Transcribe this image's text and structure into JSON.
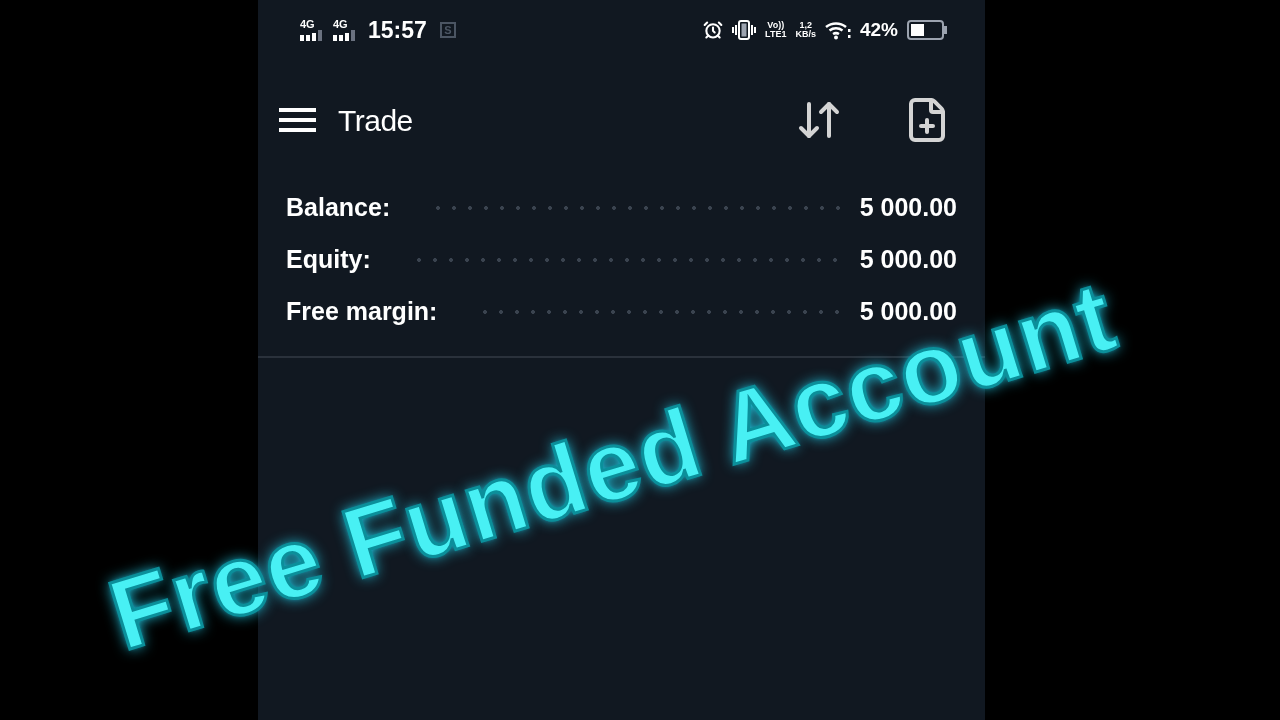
{
  "status_bar": {
    "signals": [
      {
        "label": "4G"
      },
      {
        "label": "4G"
      }
    ],
    "time": "15:57",
    "screenshot_mark": "S",
    "volte": {
      "top": "Vo))",
      "bottom": "LTE1"
    },
    "speed": {
      "value": "1,2",
      "unit": "KB/s"
    },
    "battery_percent": "42%"
  },
  "toolbar": {
    "title": "Trade"
  },
  "summary": [
    {
      "label": "Balance:",
      "value": "5 000.00"
    },
    {
      "label": "Equity:",
      "value": "5 000.00"
    },
    {
      "label": "Free margin:",
      "value": "5 000.00"
    }
  ],
  "overlay_title": "Free Funded Account"
}
